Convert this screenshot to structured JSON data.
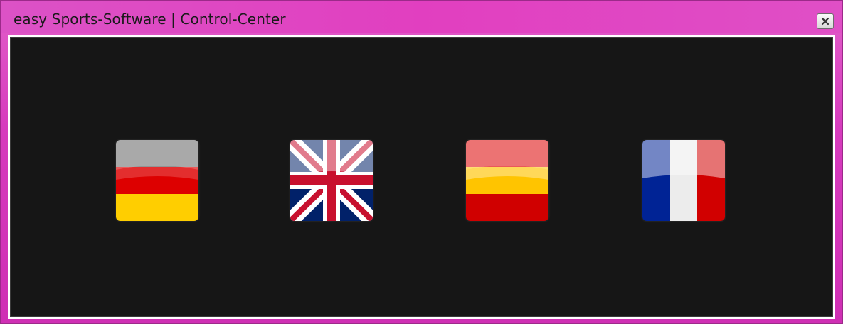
{
  "window": {
    "title": "easy Sports-Software | Control-Center",
    "close_label": "x"
  },
  "flags": [
    {
      "name": "german-flag-icon",
      "country": "Germany"
    },
    {
      "name": "uk-flag-icon",
      "country": "United Kingdom"
    },
    {
      "name": "spain-flag-icon",
      "country": "Spain"
    },
    {
      "name": "france-flag-icon",
      "country": "France"
    }
  ],
  "colors": {
    "titlebar": "#dc3fc2",
    "background": "#161616"
  }
}
